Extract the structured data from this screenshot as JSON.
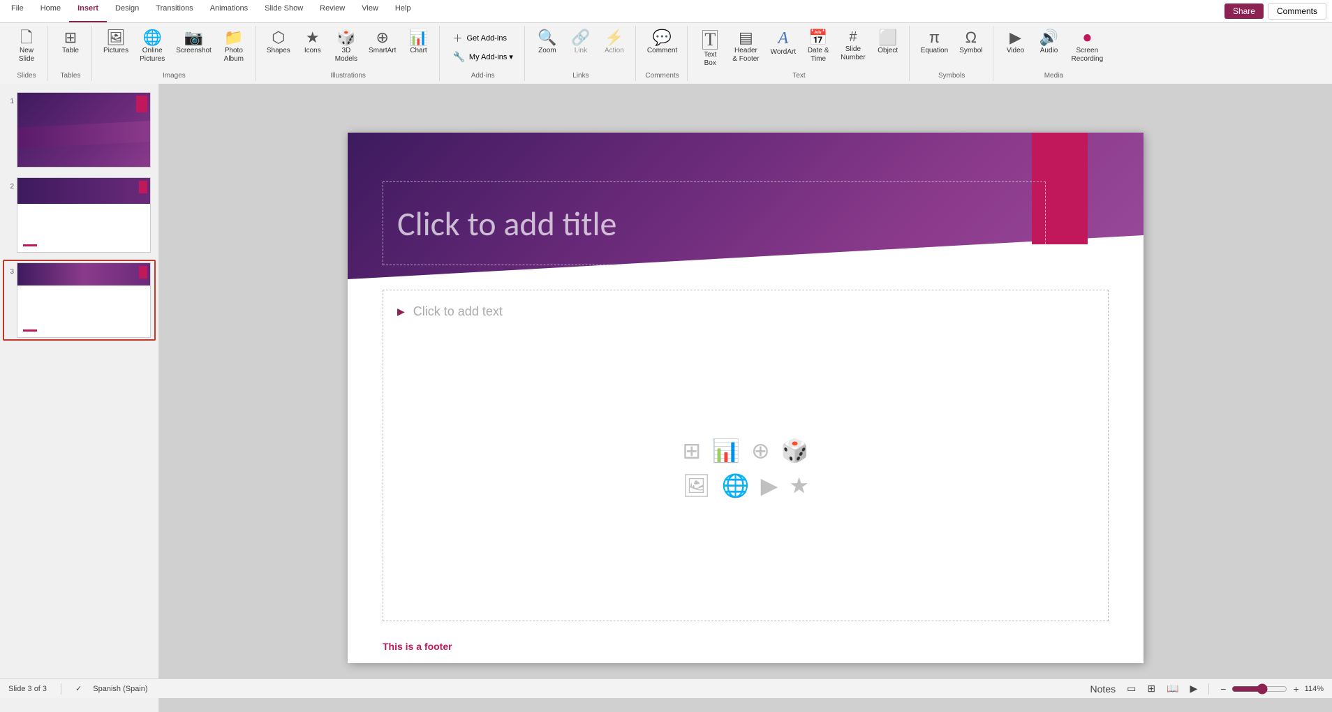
{
  "app": {
    "title": "PowerPoint"
  },
  "ribbon": {
    "tabs": [
      {
        "id": "file",
        "label": "File"
      },
      {
        "id": "home",
        "label": "Home"
      },
      {
        "id": "insert",
        "label": "Insert",
        "active": true
      },
      {
        "id": "design",
        "label": "Design"
      },
      {
        "id": "transitions",
        "label": "Transitions"
      },
      {
        "id": "animations",
        "label": "Animations"
      },
      {
        "id": "slideshow",
        "label": "Slide Show"
      },
      {
        "id": "review",
        "label": "Review"
      },
      {
        "id": "view",
        "label": "View"
      },
      {
        "id": "help",
        "label": "Help"
      }
    ],
    "groups": {
      "slides": {
        "label": "Slides",
        "buttons": [
          {
            "id": "new-slide",
            "label": "New\nSlide",
            "icon": "🗋"
          }
        ]
      },
      "tables": {
        "label": "Tables",
        "buttons": [
          {
            "id": "table",
            "label": "Table",
            "icon": "⊞"
          }
        ]
      },
      "images": {
        "label": "Images",
        "buttons": [
          {
            "id": "pictures",
            "label": "Pictures",
            "icon": "🖼"
          },
          {
            "id": "online-pictures",
            "label": "Online\nPictures",
            "icon": "🌐"
          },
          {
            "id": "screenshot",
            "label": "Screenshot",
            "icon": "📷"
          },
          {
            "id": "photo-album",
            "label": "Photo\nAlbum",
            "icon": "📁"
          }
        ]
      },
      "illustrations": {
        "label": "Illustrations",
        "buttons": [
          {
            "id": "shapes",
            "label": "Shapes",
            "icon": "⬡"
          },
          {
            "id": "icons",
            "label": "Icons",
            "icon": "★"
          },
          {
            "id": "3d-models",
            "label": "3D\nModels",
            "icon": "🎲"
          },
          {
            "id": "smartart",
            "label": "SmartArt",
            "icon": "⊕"
          },
          {
            "id": "chart",
            "label": "Chart",
            "icon": "📊"
          }
        ]
      },
      "addins": {
        "label": "Add-ins",
        "buttons": [
          {
            "id": "get-addins",
            "label": "Get Add-ins",
            "icon": "＋"
          },
          {
            "id": "my-addins",
            "label": "My Add-ins",
            "icon": "🔧"
          }
        ]
      },
      "links": {
        "label": "Links",
        "buttons": [
          {
            "id": "zoom",
            "label": "Zoom",
            "icon": "🔍"
          },
          {
            "id": "link",
            "label": "Link",
            "icon": "🔗"
          },
          {
            "id": "action",
            "label": "Action",
            "icon": "⚡"
          }
        ]
      },
      "comments": {
        "label": "Comments",
        "buttons": [
          {
            "id": "comment",
            "label": "Comment",
            "icon": "💬"
          }
        ]
      },
      "text": {
        "label": "Text",
        "buttons": [
          {
            "id": "text-box",
            "label": "Text\nBox",
            "icon": "T"
          },
          {
            "id": "header-footer",
            "label": "Header\n& Footer",
            "icon": "▤"
          },
          {
            "id": "wordart",
            "label": "WordArt",
            "icon": "A"
          },
          {
            "id": "date-time",
            "label": "Date &\nTime",
            "icon": "📅"
          },
          {
            "id": "slide-number",
            "label": "Slide\nNumber",
            "icon": "#"
          },
          {
            "id": "object",
            "label": "Object",
            "icon": "⬜"
          }
        ]
      },
      "symbols": {
        "label": "Symbols",
        "buttons": [
          {
            "id": "equation",
            "label": "Equation",
            "icon": "π"
          },
          {
            "id": "symbol",
            "label": "Symbol",
            "icon": "Ω"
          }
        ]
      },
      "media": {
        "label": "Media",
        "buttons": [
          {
            "id": "video",
            "label": "Video",
            "icon": "▶"
          },
          {
            "id": "audio",
            "label": "Audio",
            "icon": "🔊"
          },
          {
            "id": "screen-recording",
            "label": "Screen\nRecording",
            "icon": "⏺"
          }
        ]
      }
    },
    "share_label": "Share",
    "comments_label": "Comments"
  },
  "slides": [
    {
      "number": "1",
      "active": false
    },
    {
      "number": "2",
      "active": false
    },
    {
      "number": "3",
      "active": true
    }
  ],
  "slide": {
    "title_placeholder": "Click to add title",
    "content_placeholder": "Click to add text",
    "footer_text": "This is a footer"
  },
  "status_bar": {
    "slide_info": "Slide 3 of 3",
    "language": "Spanish (Spain)",
    "notes_label": "Notes",
    "zoom_level": "114%"
  }
}
